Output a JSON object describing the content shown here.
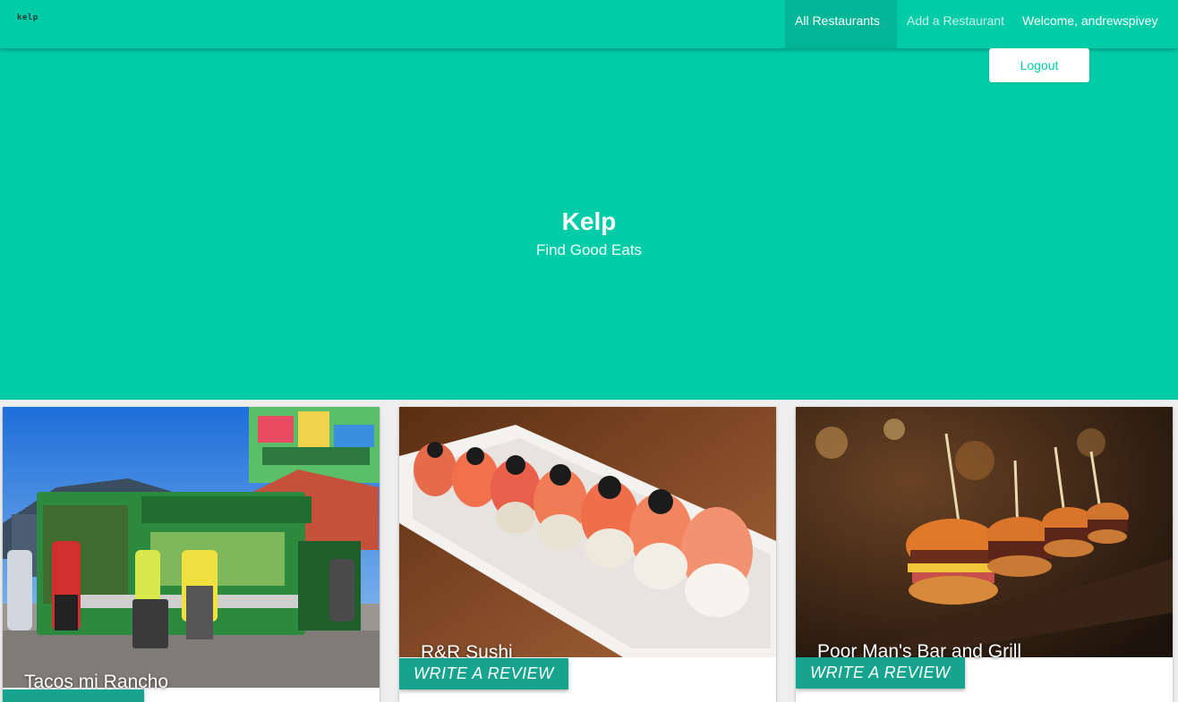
{
  "nav": {
    "brand": "kelp",
    "all_restaurants": "All Restaurants",
    "add_restaurant": "Add a Restaurant",
    "welcome": "Welcome, andrewspivey",
    "logout": "Logout"
  },
  "hero": {
    "title": "Kelp",
    "subtitle": "Find Good Eats"
  },
  "restaurants": [
    {
      "name": "Tacos mi Rancho",
      "review_label": ""
    },
    {
      "name": "R&R Sushi",
      "review_label": "WRITE A REVIEW"
    },
    {
      "name": "Poor Man's Bar and Grill",
      "review_label": "WRITE A REVIEW"
    }
  ],
  "colors": {
    "brand": "#00cca8",
    "nav_active": "#02b597",
    "review_button": "#17a48e"
  }
}
